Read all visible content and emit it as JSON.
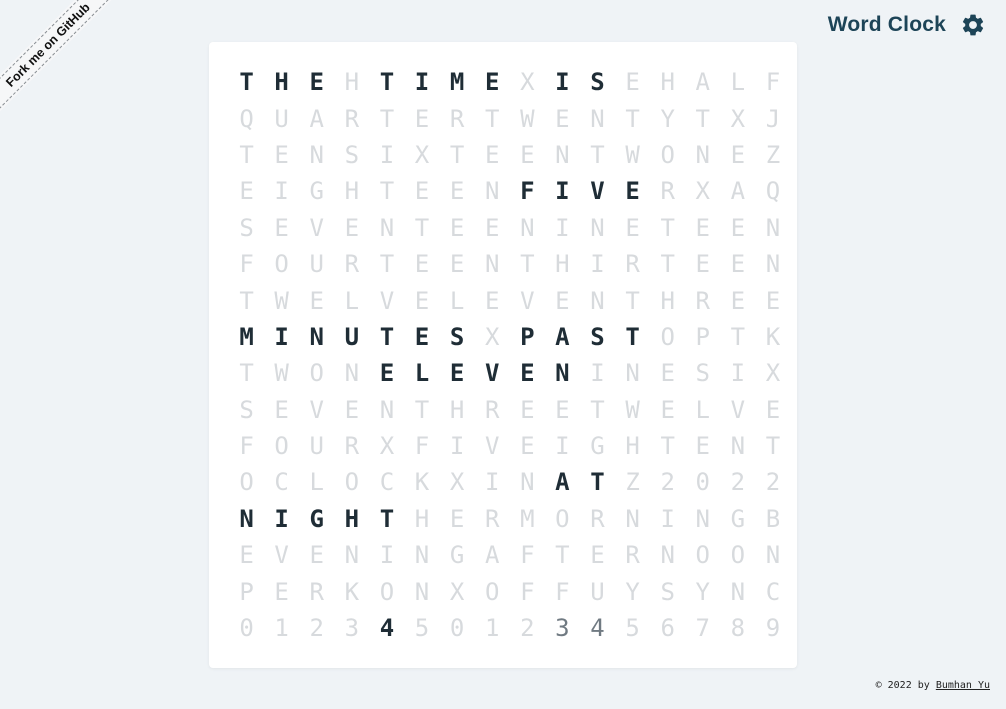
{
  "ribbon": {
    "label": "Fork me on GitHub"
  },
  "header": {
    "title": "Word Clock",
    "settings_icon": "gear-icon"
  },
  "clock": {
    "rows": [
      "THEHTIMEXISEHALF",
      "QUARTERTWENTYTXJ",
      "TENSIXTEENTWONEZ",
      "EIGHTEENFIVERXAQ",
      "SEVENTEENINETEEN",
      "FOURTEENTHIRTEEN",
      "TWELVELEVENTHREE",
      "MINUTESXPASTOPTK",
      "TWONELEVENINESIX",
      "SEVENTHREETWELVE",
      "FOURXFIVEIGHTENT",
      "OCLOCKXINATZ2022",
      "NIGHTHERMORNINGB",
      "EVENINGAFTERNOON",
      "PERKONXOFFUYSYNC",
      "0123450123456789"
    ],
    "highlighted": [
      [
        0,
        0
      ],
      [
        0,
        1
      ],
      [
        0,
        2
      ],
      [
        0,
        4
      ],
      [
        0,
        5
      ],
      [
        0,
        6
      ],
      [
        0,
        7
      ],
      [
        0,
        9
      ],
      [
        0,
        10
      ],
      [
        3,
        8
      ],
      [
        3,
        9
      ],
      [
        3,
        10
      ],
      [
        3,
        11
      ],
      [
        7,
        0
      ],
      [
        7,
        1
      ],
      [
        7,
        2
      ],
      [
        7,
        3
      ],
      [
        7,
        4
      ],
      [
        7,
        5
      ],
      [
        7,
        6
      ],
      [
        7,
        8
      ],
      [
        7,
        9
      ],
      [
        7,
        10
      ],
      [
        7,
        11
      ],
      [
        8,
        4
      ],
      [
        8,
        5
      ],
      [
        8,
        6
      ],
      [
        8,
        7
      ],
      [
        8,
        8
      ],
      [
        8,
        9
      ],
      [
        11,
        9
      ],
      [
        11,
        10
      ],
      [
        12,
        0
      ],
      [
        12,
        1
      ],
      [
        12,
        2
      ],
      [
        12,
        3
      ],
      [
        12,
        4
      ],
      [
        15,
        4
      ]
    ],
    "dimmed": [
      [
        15,
        9
      ],
      [
        15,
        10
      ]
    ]
  },
  "footer": {
    "prefix": "© 2022 by ",
    "author": "Bumhan Yu"
  }
}
